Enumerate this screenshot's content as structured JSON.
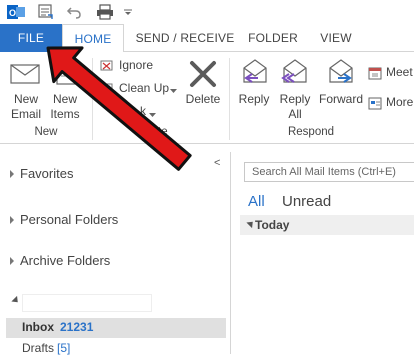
{
  "ribbon_tabs": [
    "FILE",
    "HOME",
    "SEND / RECEIVE",
    "FOLDER",
    "VIEW"
  ],
  "new_group": {
    "new_email": [
      "New",
      "Email"
    ],
    "new_items": [
      "New",
      "Items"
    ],
    "label": "New"
  },
  "delete_group": {
    "ignore": "Ignore",
    "clean_up": "Clean Up",
    "junk_partial": "k",
    "delete": "Delete",
    "label_partial": "te"
  },
  "respond_group": {
    "reply": "Reply",
    "reply_all": [
      "Reply",
      "All"
    ],
    "forward": "Forward",
    "meeting_partial": "Meet",
    "more_partial": "More",
    "label": "Respond"
  },
  "nav": {
    "favorites": "Favorites",
    "personal_folders": "Personal Folders",
    "archive_folders": "Archive Folders",
    "inbox_label": "Inbox",
    "inbox_count": "21231",
    "drafts_label": "Drafts",
    "drafts_count": "[5]",
    "collapse_glyph": "<"
  },
  "mail_list": {
    "search_placeholder": "Search All Mail Items (Ctrl+E)",
    "filter_all": "All",
    "filter_unread": "Unread",
    "group_today": "Today"
  },
  "colors": {
    "accent": "#2a72c8",
    "arrow_red": "#e01818"
  },
  "icons": [
    "outlook-logo-icon",
    "send-receive-all-icon",
    "undo-icon",
    "print-icon",
    "qat-customize-icon",
    "new-email-icon",
    "new-items-icon",
    "ignore-icon",
    "clean-up-icon",
    "delete-icon",
    "reply-icon",
    "reply-all-icon",
    "forward-icon",
    "meeting-icon",
    "more-icon",
    "red-arrow-annotation"
  ]
}
